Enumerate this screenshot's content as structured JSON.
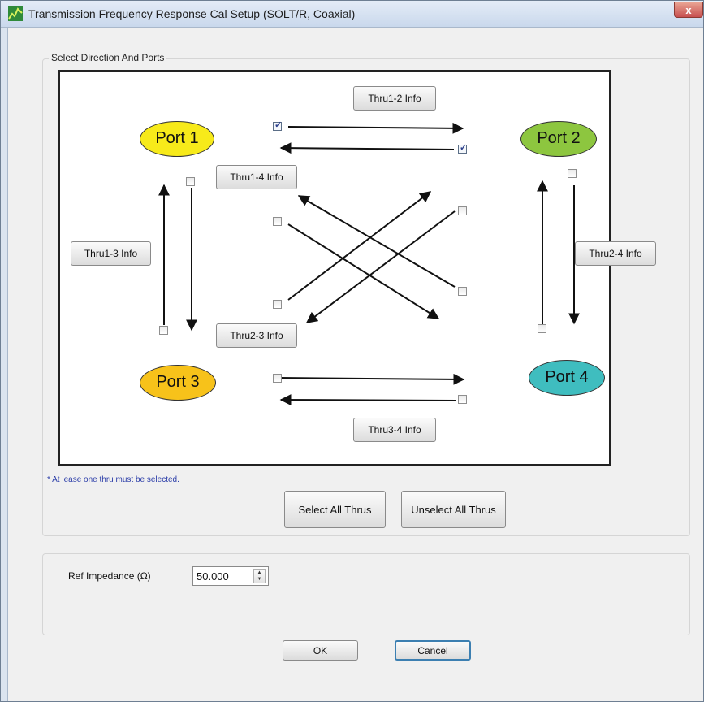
{
  "window": {
    "title": "Transmission Frequency Response Cal Setup (SOLT/R, Coaxial)",
    "close_label": "x"
  },
  "group_direction": {
    "title": "Select Direction And Ports",
    "ports": {
      "p1": {
        "label": "Port 1",
        "color": "#f7ea1a"
      },
      "p2": {
        "label": "Port 2",
        "color": "#8dc63f"
      },
      "p3": {
        "label": "Port 3",
        "color": "#f7c21a"
      },
      "p4": {
        "label": "Port 4",
        "color": "#3fbdbf"
      }
    },
    "info_buttons": {
      "thru12": "Thru1-2 Info",
      "thru14": "Thru1-4 Info",
      "thru13": "Thru1-3 Info",
      "thru24": "Thru2-4 Info",
      "thru23": "Thru2-3 Info",
      "thru34": "Thru3-4 Info"
    },
    "thru_checks": {
      "p1_to_p2": true,
      "p2_to_p1": true,
      "p1_to_p3": false,
      "p3_to_p1": false,
      "p2_to_p4": false,
      "p4_to_p2": false,
      "p1_to_p4": false,
      "p4_to_p1": false,
      "p2_to_p3": false,
      "p3_to_p2": false,
      "p3_to_p4": false,
      "p4_to_p3": false
    },
    "note": "* At lease one thru must be selected.",
    "select_all_label": "Select All Thrus",
    "unselect_all_label": "Unselect All Thrus"
  },
  "impedance": {
    "label": "Ref Impedance (Ω)",
    "value": "50.000"
  },
  "buttons": {
    "ok_label": "OK",
    "cancel_label": "Cancel"
  }
}
